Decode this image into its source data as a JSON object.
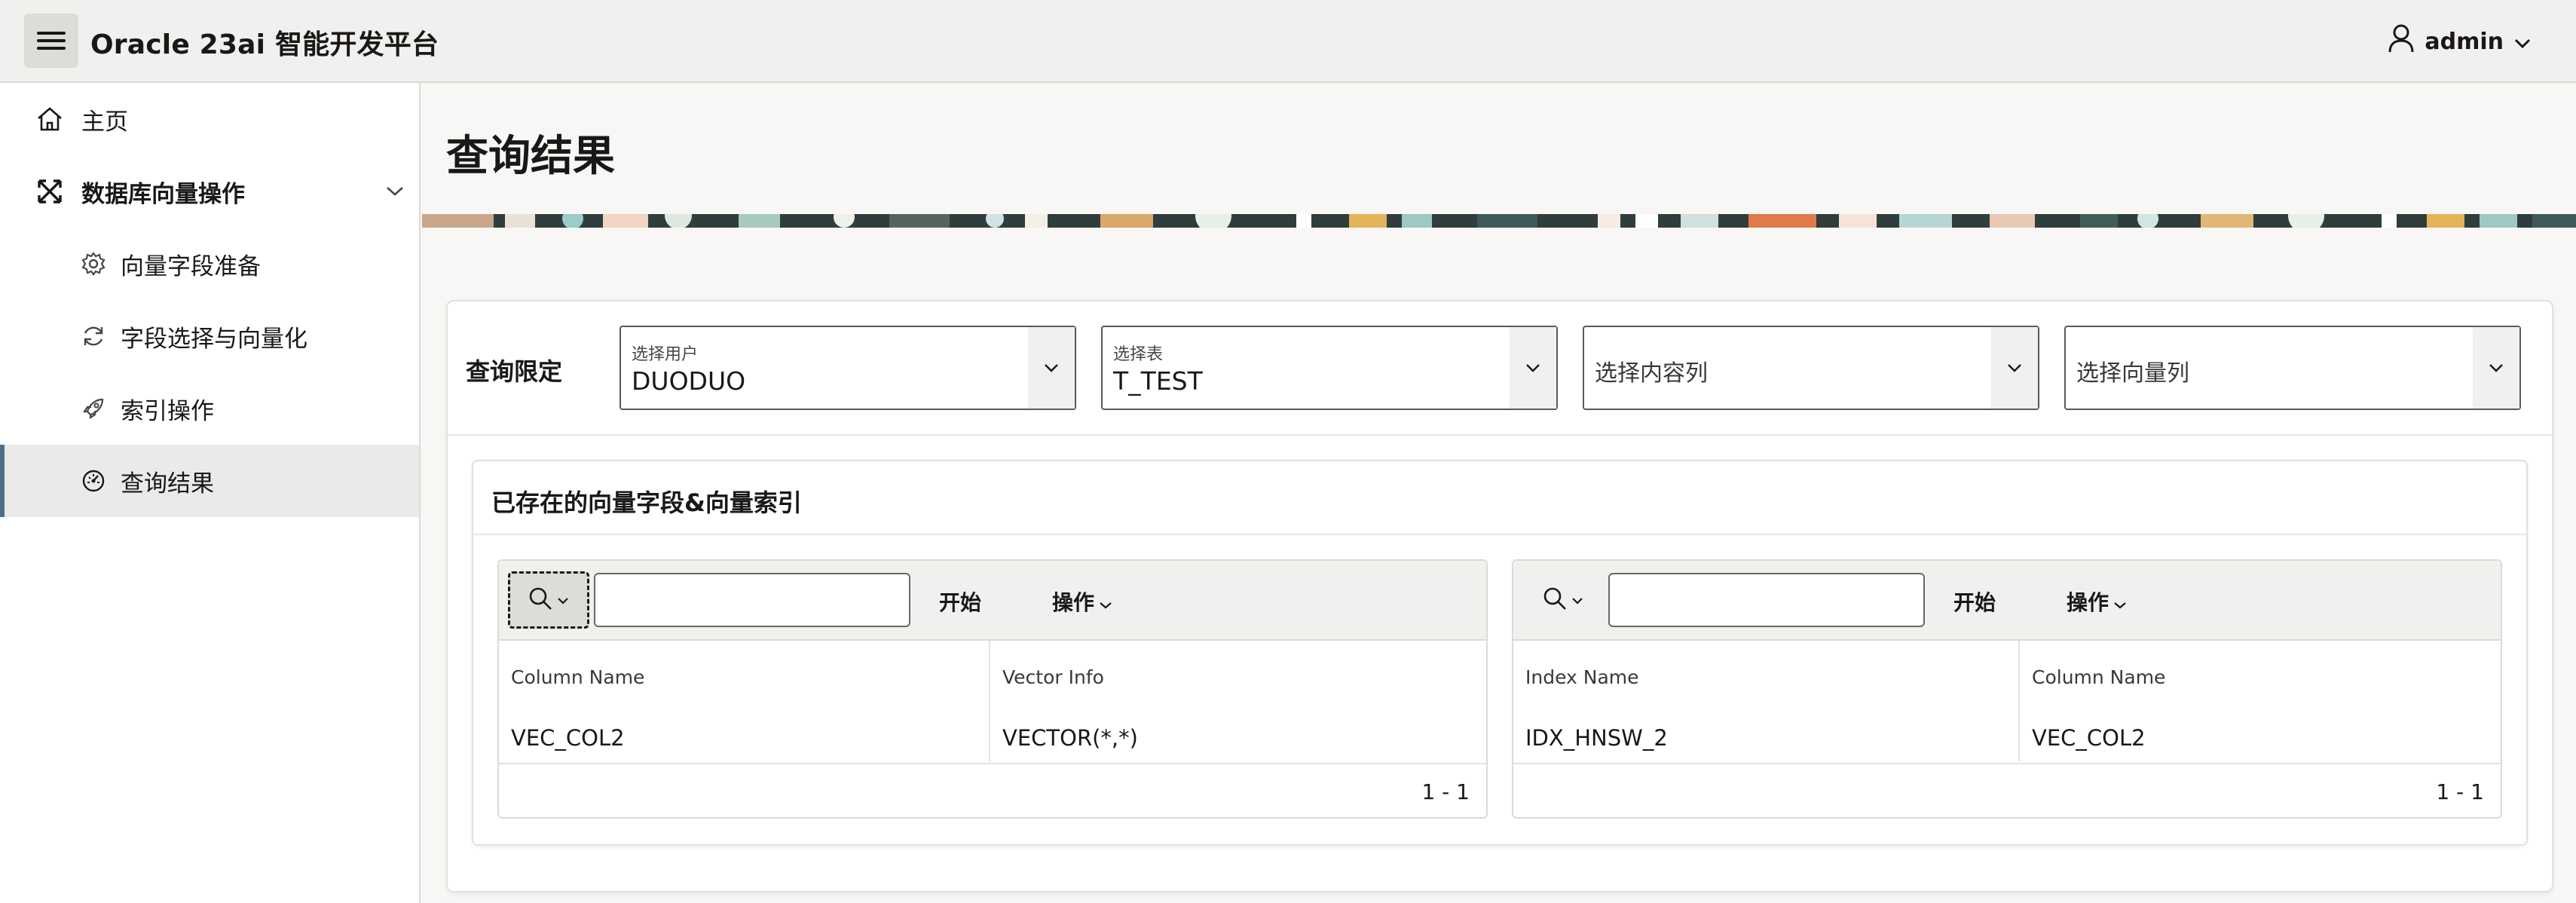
{
  "header": {
    "app_title": "Oracle 23ai 智能开发平台",
    "menu_icon": "hamburger-menu-icon",
    "user": {
      "icon": "user-icon",
      "name": "admin",
      "dropdown_icon": "chevron-down-icon"
    }
  },
  "sidebar": {
    "items": [
      {
        "label": "主页",
        "icon": "home-icon"
      },
      {
        "label": "数据库向量操作",
        "icon": "shuffle-icon",
        "expanded": true
      },
      {
        "label": "向量字段准备",
        "icon": "gear-icon"
      },
      {
        "label": "字段选择与向量化",
        "icon": "refresh-icon"
      },
      {
        "label": "索引操作",
        "icon": "rocket-icon"
      },
      {
        "label": "查询结果",
        "icon": "gauge-icon",
        "active": true
      }
    ]
  },
  "page": {
    "title": "查询结果",
    "filters": {
      "label": "查询限定",
      "user_select": {
        "label": "选择用户",
        "value": "DUODUO"
      },
      "table_select": {
        "label": "选择表",
        "value": "T_TEST"
      },
      "content_column_select": {
        "placeholder": "选择内容列"
      },
      "vector_column_select": {
        "placeholder": "选择向量列"
      }
    },
    "region": {
      "title": "已存在的向量字段&向量索引",
      "left_report": {
        "go_label": "开始",
        "actions_label": "操作",
        "columns": [
          "Column Name",
          "Vector Info"
        ],
        "rows": [
          [
            "VEC_COL2",
            "VECTOR(*,*)"
          ]
        ],
        "pagination": "1 - 1"
      },
      "right_report": {
        "go_label": "开始",
        "actions_label": "操作",
        "columns": [
          "Index Name",
          "Column Name"
        ],
        "rows": [
          [
            "IDX_HNSW_2",
            "VEC_COL2"
          ]
        ],
        "pagination": "1 - 1"
      }
    }
  },
  "colors": {
    "header_bg": "#f1f0ee",
    "active_indicator": "#4b6f8a",
    "banner_dark": "#2f3e3d"
  }
}
